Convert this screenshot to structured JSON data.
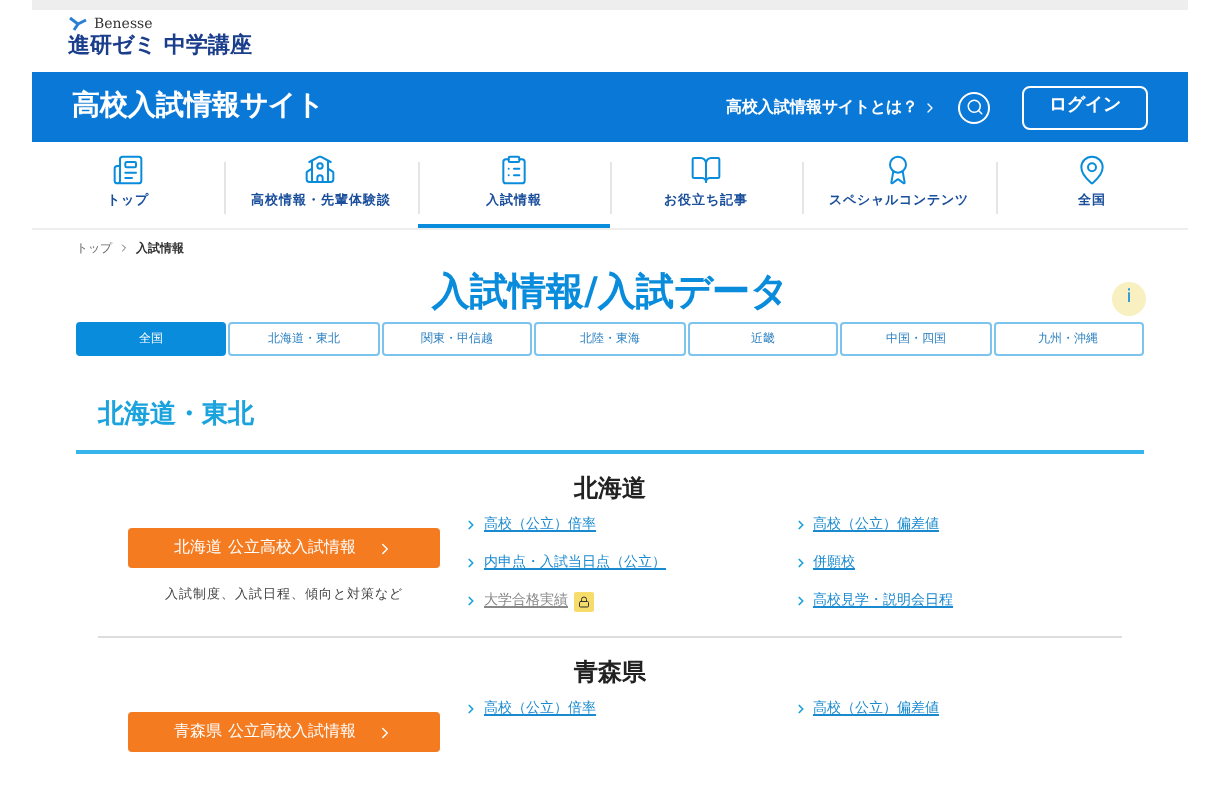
{
  "brand": {
    "company": "Benesse",
    "product": "進研ゼミ 中学講座"
  },
  "header": {
    "title": "高校入試情報サイト",
    "about_link": "高校入試情報サイトとは？",
    "login": "ログイン"
  },
  "nav": [
    {
      "label": "トップ",
      "selected": false
    },
    {
      "label": "高校情報・先輩体験談",
      "selected": false
    },
    {
      "label": "入試情報",
      "selected": true
    },
    {
      "label": "お役立ち記事",
      "selected": false
    },
    {
      "label": "スペシャルコンテンツ",
      "selected": false
    },
    {
      "label": "全国",
      "selected": false
    }
  ],
  "breadcrumb": [
    "トップ",
    "入試情報"
  ],
  "page_title": "入試情報/入試データ",
  "info_badge": "i",
  "region_tabs": [
    {
      "label": "全国",
      "selected": true
    },
    {
      "label": "北海道・東北",
      "selected": false
    },
    {
      "label": "関東・甲信越",
      "selected": false
    },
    {
      "label": "北陸・東海",
      "selected": false
    },
    {
      "label": "近畿",
      "selected": false
    },
    {
      "label": "中国・四国",
      "selected": false
    },
    {
      "label": "九州・沖縄",
      "selected": false
    }
  ],
  "section_title": "北海道・東北",
  "prefectures": [
    {
      "name": "北海道",
      "button": "北海道 公立高校入試情報",
      "description": "入試制度、入試日程、傾向と対策など",
      "links": [
        {
          "text": "高校（公立）倍率",
          "locked": false
        },
        {
          "text": "高校（公立）偏差値",
          "locked": false
        },
        {
          "text": "内申点・入試当日点（公立）",
          "locked": false
        },
        {
          "text": "併願校",
          "locked": false
        },
        {
          "text": "大学合格実績",
          "locked": true
        },
        {
          "text": "高校見学・説明会日程",
          "locked": false
        }
      ]
    },
    {
      "name": "青森県",
      "button": "青森県 公立高校入試情報",
      "links": [
        {
          "text": "高校（公立）倍率",
          "locked": false
        },
        {
          "text": "高校（公立）偏差値",
          "locked": false
        }
      ]
    }
  ]
}
